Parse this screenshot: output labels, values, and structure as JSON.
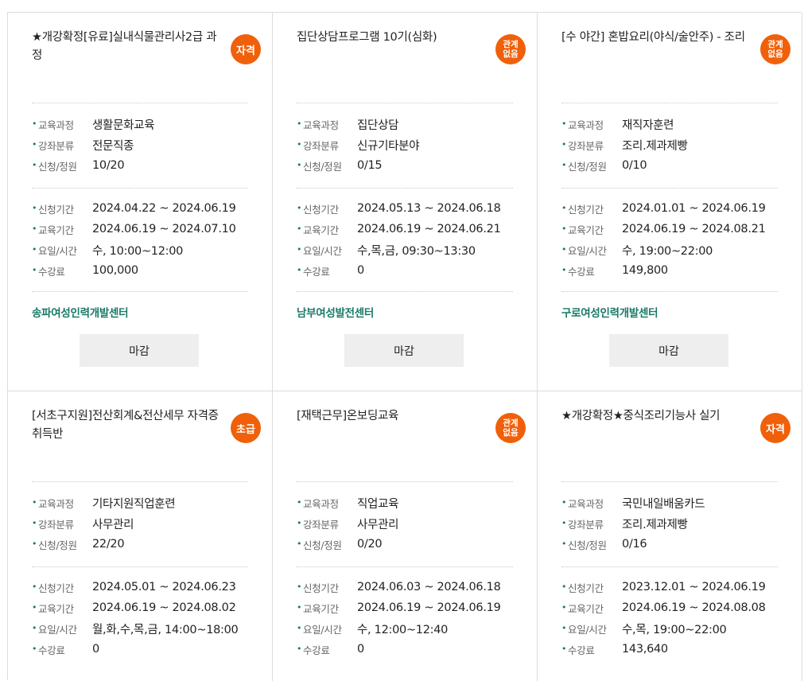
{
  "labels": {
    "course": "교육과정",
    "category": "강좌분류",
    "enroll": "신청/정원",
    "apply_period": "신청기간",
    "edu_period": "교육기간",
    "day_time": "요일/시간",
    "fee": "수강료"
  },
  "cards": [
    {
      "title": "★개강확정[유료]실내식물관리사2급 과정",
      "badge": "자격",
      "course": "생활문화교육",
      "category": "전문직종",
      "enroll": "10/20",
      "apply_period": "2024.04.22 ~ 2024.06.19",
      "edu_period": "2024.06.19 ~ 2024.07.10",
      "day_time": "수, 10:00~12:00",
      "fee": "100,000",
      "center": "송파여성인력개발센터",
      "button": "마감"
    },
    {
      "title": "집단상담프로그램 10기(심화)",
      "badge": "관계\n없음",
      "course": "집단상담",
      "category": "신규기타분야",
      "enroll": "0/15",
      "apply_period": "2024.05.13 ~ 2024.06.18",
      "edu_period": "2024.06.19 ~ 2024.06.21",
      "day_time": "수,목,금, 09:30~13:30",
      "fee": "0",
      "center": "남부여성발전센터",
      "button": "마감"
    },
    {
      "title": "[수 야간] 혼밥요리(야식/술안주) - 조리",
      "badge": "관계\n없음",
      "course": "재직자훈련",
      "category": "조리.제과제빵",
      "enroll": "0/10",
      "apply_period": "2024.01.01 ~ 2024.06.19",
      "edu_period": "2024.06.19 ~ 2024.08.21",
      "day_time": "수, 19:00~22:00",
      "fee": "149,800",
      "center": "구로여성인력개발센터",
      "button": "마감"
    },
    {
      "title": "[서초구지원]전산회계&전산세무 자격증 취득반",
      "badge": "초급",
      "course": "기타지원직업훈련",
      "category": "사무관리",
      "enroll": "22/20",
      "apply_period": "2024.05.01 ~ 2024.06.23",
      "edu_period": "2024.06.19 ~ 2024.08.02",
      "day_time": "월,화,수,목,금, 14:00~18:00",
      "fee": "0"
    },
    {
      "title": "[재택근무]온보딩교육",
      "badge": "관계\n없음",
      "course": "직업교육",
      "category": "사무관리",
      "enroll": "0/20",
      "apply_period": "2024.06.03 ~ 2024.06.18",
      "edu_period": "2024.06.19 ~ 2024.06.19",
      "day_time": "수, 12:00~12:40",
      "fee": "0"
    },
    {
      "title": "★개강확정★중식조리기능사 실기",
      "badge": "자격",
      "course": "국민내일배움카드",
      "category": "조리.제과제빵",
      "enroll": "0/16",
      "apply_period": "2023.12.01 ~ 2024.06.19",
      "edu_period": "2024.06.19 ~ 2024.08.08",
      "day_time": "수,목, 19:00~22:00",
      "fee": "143,640"
    }
  ],
  "colors": {
    "badge": "#f0600a",
    "center_text": "#1a7a66",
    "button_bg": "#eeeeee"
  }
}
